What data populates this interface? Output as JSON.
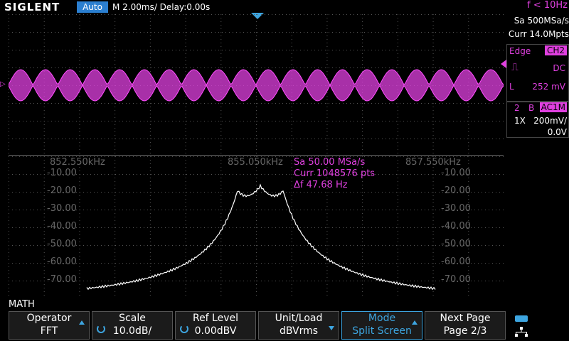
{
  "header": {
    "logo": "SIGLENT",
    "trigger_mode": "Auto",
    "timebase": "M 2.00ms/ Delay:0.00s",
    "freq": "f < 10Hz"
  },
  "right_panel": {
    "sample_rate": "Sa 500MSa/s",
    "memory": "Curr 14.0Mpts",
    "trigger_type": "Edge",
    "trigger_source": "CH2",
    "coupling": "DC",
    "level_label": "L",
    "level_value": "252 mV",
    "channel_number": "2",
    "bandwidth_flag": "B",
    "channel_coupling": "AC1M",
    "probe": "1X",
    "volts_div": "200mV/",
    "offset": "0.0V"
  },
  "fft": {
    "freq_labels": [
      "852.550kHz",
      "855.050kHz",
      "857.550kHz"
    ],
    "db_labels": [
      "-10.00",
      "-20.00",
      "-30.00",
      "-40.00",
      "-50.00",
      "-60.00",
      "-70.00"
    ],
    "info_sa": "Sa 50.00 MSa/s",
    "info_curr": "Curr 1048576 pts",
    "info_df": "Δf 47.68 Hz"
  },
  "math_label": "MATH",
  "softkeys": [
    {
      "l1": "Operator",
      "l2": "FFT"
    },
    {
      "l1": "Scale",
      "l2": "10.0dB/"
    },
    {
      "l1": "Ref Level",
      "l2": "0.00dBV"
    },
    {
      "l1": "Unit/Load",
      "l2": "dBVrms"
    },
    {
      "l1": "Mode",
      "l2": "Split Screen"
    },
    {
      "l1": "Next Page",
      "l2": "Page 2/3"
    }
  ],
  "colors": {
    "ch2": "#e040e0",
    "accent": "#3da5e0",
    "trace": "#ffffff"
  },
  "icons": [
    "usb-icon",
    "network-icon"
  ]
}
